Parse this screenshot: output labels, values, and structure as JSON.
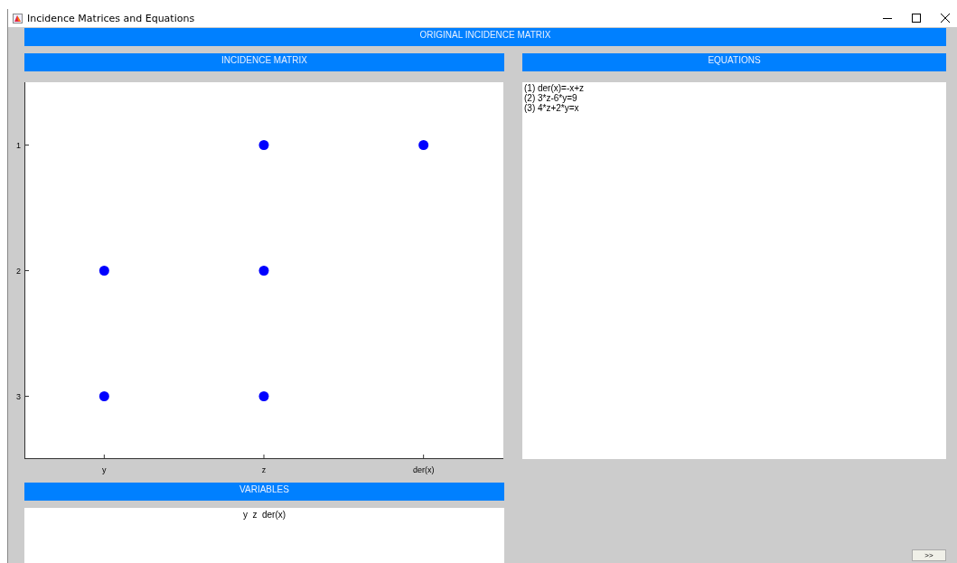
{
  "window": {
    "title": "Incidence Matrices and Equations"
  },
  "banner": "ORIGINAL INCIDENCE MATRIX",
  "matrix_panel": {
    "header": "INCIDENCE MATRIX",
    "chart_data": {
      "type": "scatter",
      "categories": [
        "y",
        "z",
        "der(x)"
      ],
      "series": [
        {
          "color": "#0000ff",
          "values": [
            null,
            1,
            1
          ]
        },
        {
          "color": "#0000ff",
          "values": [
            2,
            2,
            null
          ]
        },
        {
          "color": "#0000ff",
          "values": [
            3,
            3,
            null
          ]
        }
      ],
      "yticks": [
        1,
        2,
        3
      ],
      "ylim": [
        3.5,
        0.5
      ]
    }
  },
  "equations_panel": {
    "header": "EQUATIONS",
    "lines": [
      "(1) der(x)=-x+z",
      "(2) 3*z-6*y=9",
      "(3) 4*z+2*y=x"
    ]
  },
  "variables_panel": {
    "header": "VARIABLES",
    "text": "y  z  der(x)"
  },
  "next_button": ">>"
}
